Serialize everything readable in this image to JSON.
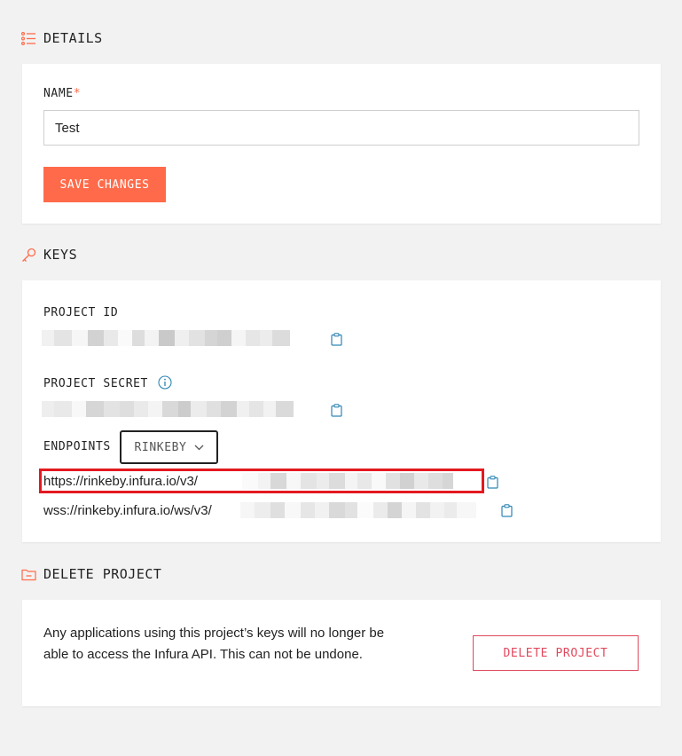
{
  "details": {
    "title": "DETAILS",
    "name_label": "NAME",
    "required_mark": "*",
    "name_value": "Test",
    "save_label": "SAVE CHANGES"
  },
  "keys": {
    "title": "KEYS",
    "project_id_label": "PROJECT ID",
    "project_secret_label": "PROJECT SECRET",
    "endpoints_label": "ENDPOINTS",
    "network_selected": "RINKEBY",
    "https_endpoint": "https://rinkeby.infura.io/v3/",
    "wss_endpoint": "wss://rinkeby.infura.io/ws/v3/"
  },
  "delete": {
    "title": "DELETE PROJECT",
    "warning": "Any applications using this project’s keys will no longer be able to access the Infura API. This can not be undone.",
    "button_label": "DELETE PROJECT"
  },
  "colors": {
    "accent": "#ff6b4a",
    "danger": "#e0495d",
    "highlight": "#e3191f",
    "icon_blue": "#2e86b4",
    "background": "#f2f2f2"
  },
  "icons": [
    "list-icon",
    "key-icon",
    "info-icon",
    "clipboard-icon",
    "chevron-down-icon",
    "folder-minus-icon"
  ]
}
